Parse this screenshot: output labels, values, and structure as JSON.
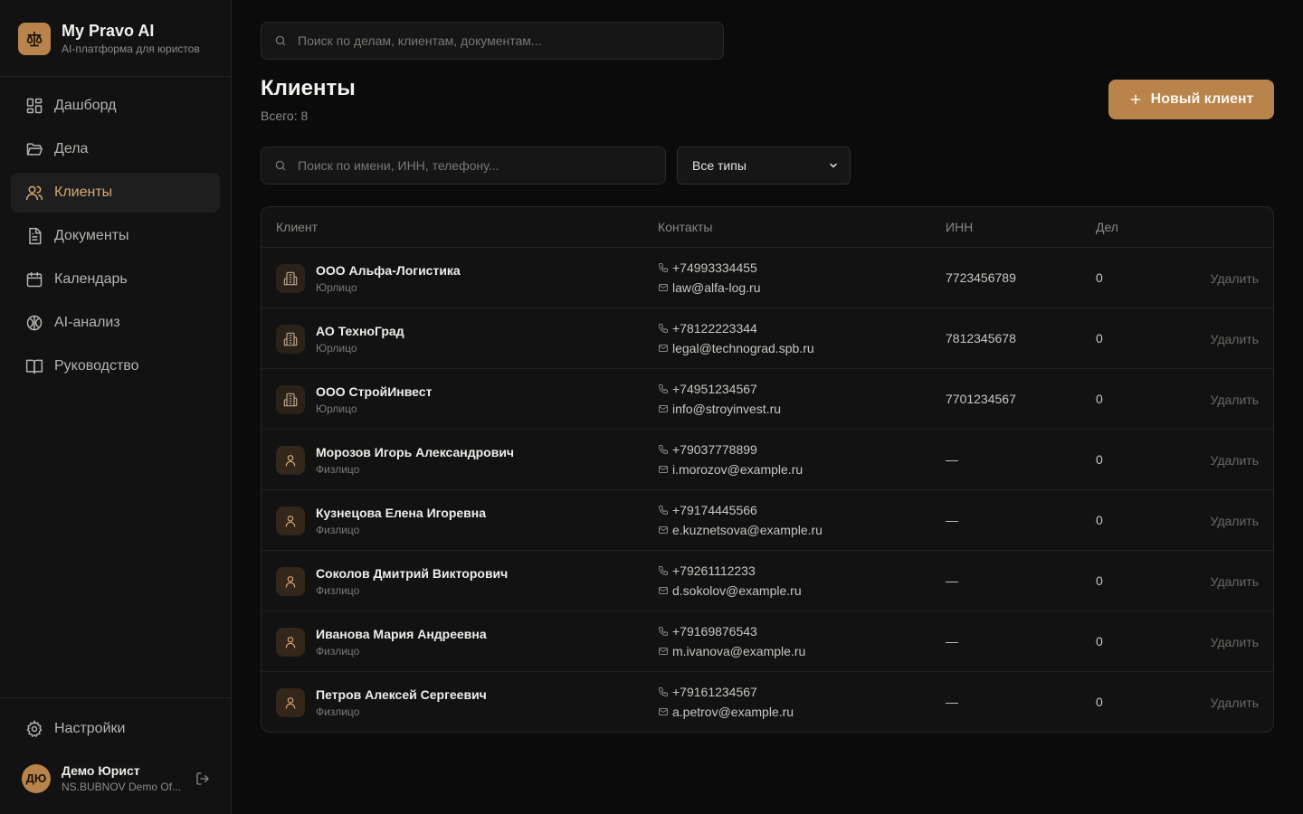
{
  "brand": {
    "title": "My Pravo AI",
    "subtitle": "AI-платформа для юристов",
    "logo_icon": "scales-icon",
    "accent": "#b9844b"
  },
  "nav": [
    {
      "label": "Дашборд",
      "icon": "grid-icon",
      "active": false
    },
    {
      "label": "Дела",
      "icon": "folder-icon",
      "active": false
    },
    {
      "label": "Клиенты",
      "icon": "users-icon",
      "active": true
    },
    {
      "label": "Документы",
      "icon": "document-icon",
      "active": false
    },
    {
      "label": "Календарь",
      "icon": "calendar-icon",
      "active": false
    },
    {
      "label": "AI-анализ",
      "icon": "brain-icon",
      "active": false
    },
    {
      "label": "Руководство",
      "icon": "book-icon",
      "active": false
    }
  ],
  "settings": {
    "label": "Настройки",
    "icon": "gear-icon"
  },
  "user": {
    "initials": "ДЮ",
    "name": "Демо Юрист",
    "org": "NS.BUBNOV Demo Of..."
  },
  "top_search": {
    "placeholder": "Поиск по делам, клиентам, документам..."
  },
  "page": {
    "title": "Клиенты",
    "count": "Всего: 8",
    "new_button": "Новый клиент"
  },
  "filters": {
    "search_placeholder": "Поиск по имени, ИНН, телефону...",
    "type_selected": "Все типы"
  },
  "table": {
    "headers": [
      "Клиент",
      "Контакты",
      "ИНН",
      "Дел"
    ],
    "delete_label": "Удалить",
    "rows": [
      {
        "name": "ООО Альфа-Логистика",
        "type": "Юрлицо",
        "kind": "company",
        "phone": "+74993334455",
        "email": "law@alfa-log.ru",
        "inn": "7723456789",
        "cases": "0"
      },
      {
        "name": "АО ТехноГрад",
        "type": "Юрлицо",
        "kind": "company",
        "phone": "+78122223344",
        "email": "legal@technograd.spb.ru",
        "inn": "7812345678",
        "cases": "0"
      },
      {
        "name": "ООО СтройИнвест",
        "type": "Юрлицо",
        "kind": "company",
        "phone": "+74951234567",
        "email": "info@stroyinvest.ru",
        "inn": "7701234567",
        "cases": "0"
      },
      {
        "name": "Морозов Игорь Александрович",
        "type": "Физлицо",
        "kind": "person",
        "phone": "+79037778899",
        "email": "i.morozov@example.ru",
        "inn": "—",
        "cases": "0"
      },
      {
        "name": "Кузнецова Елена Игоревна",
        "type": "Физлицо",
        "kind": "person",
        "phone": "+79174445566",
        "email": "e.kuznetsova@example.ru",
        "inn": "—",
        "cases": "0"
      },
      {
        "name": "Соколов Дмитрий Викторович",
        "type": "Физлицо",
        "kind": "person",
        "phone": "+79261112233",
        "email": "d.sokolov@example.ru",
        "inn": "—",
        "cases": "0"
      },
      {
        "name": "Иванова Мария Андреевна",
        "type": "Физлицо",
        "kind": "person",
        "phone": "+79169876543",
        "email": "m.ivanova@example.ru",
        "inn": "—",
        "cases": "0"
      },
      {
        "name": "Петров Алексей Сергеевич",
        "type": "Физлицо",
        "kind": "person",
        "phone": "+79161234567",
        "email": "a.petrov@example.ru",
        "inn": "—",
        "cases": "0"
      }
    ]
  }
}
